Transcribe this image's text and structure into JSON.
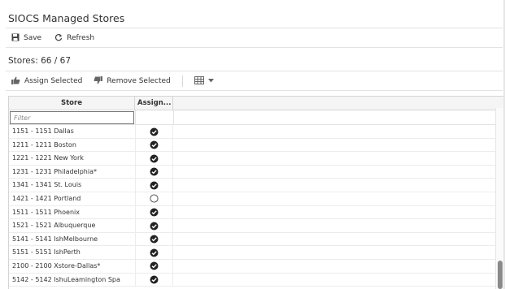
{
  "page_title": "SIOCS Managed Stores",
  "toolbar": {
    "save_label": "Save",
    "refresh_label": "Refresh"
  },
  "stores_count": "Stores: 66 / 67",
  "actions": {
    "assign_label": "Assign Selected",
    "remove_label": "Remove Selected"
  },
  "grid": {
    "col_store": "Store",
    "col_assign": "Assign...",
    "filter_placeholder": "Filter",
    "rows": [
      {
        "store": "1151 - 1151 Dallas",
        "assigned": true
      },
      {
        "store": "1211 - 1211 Boston",
        "assigned": true
      },
      {
        "store": "1221 - 1221 New York",
        "assigned": true
      },
      {
        "store": "1231 - 1231 Philadelphia*",
        "assigned": true
      },
      {
        "store": "1341 - 1341 St. Louis",
        "assigned": true
      },
      {
        "store": "1421 - 1421 Portland",
        "assigned": false
      },
      {
        "store": "1511 - 1511 Phoenix",
        "assigned": true
      },
      {
        "store": "1521 - 1521 Albuquerque",
        "assigned": true
      },
      {
        "store": "5141 - 5141 IshMelbourne",
        "assigned": true
      },
      {
        "store": "5151 - 5151 IshPerth",
        "assigned": true
      },
      {
        "store": "2100 - 2100 Xstore-Dallas*",
        "assigned": true
      },
      {
        "store": "5142 - 5142 IshuLeamington Spa",
        "assigned": true
      }
    ]
  },
  "icons": {
    "save": "floppy-disk-icon",
    "refresh": "refresh-icon",
    "assign": "thumbs-up-icon",
    "remove": "thumbs-down-icon",
    "view": "grid-view-icon",
    "dropdown": "caret-down-icon",
    "assigned": "check-circle-icon",
    "unassigned": "empty-circle-icon"
  },
  "colors": {
    "text": "#333333",
    "border": "#d5d5d5",
    "header_bg": "#f5f5f5"
  }
}
